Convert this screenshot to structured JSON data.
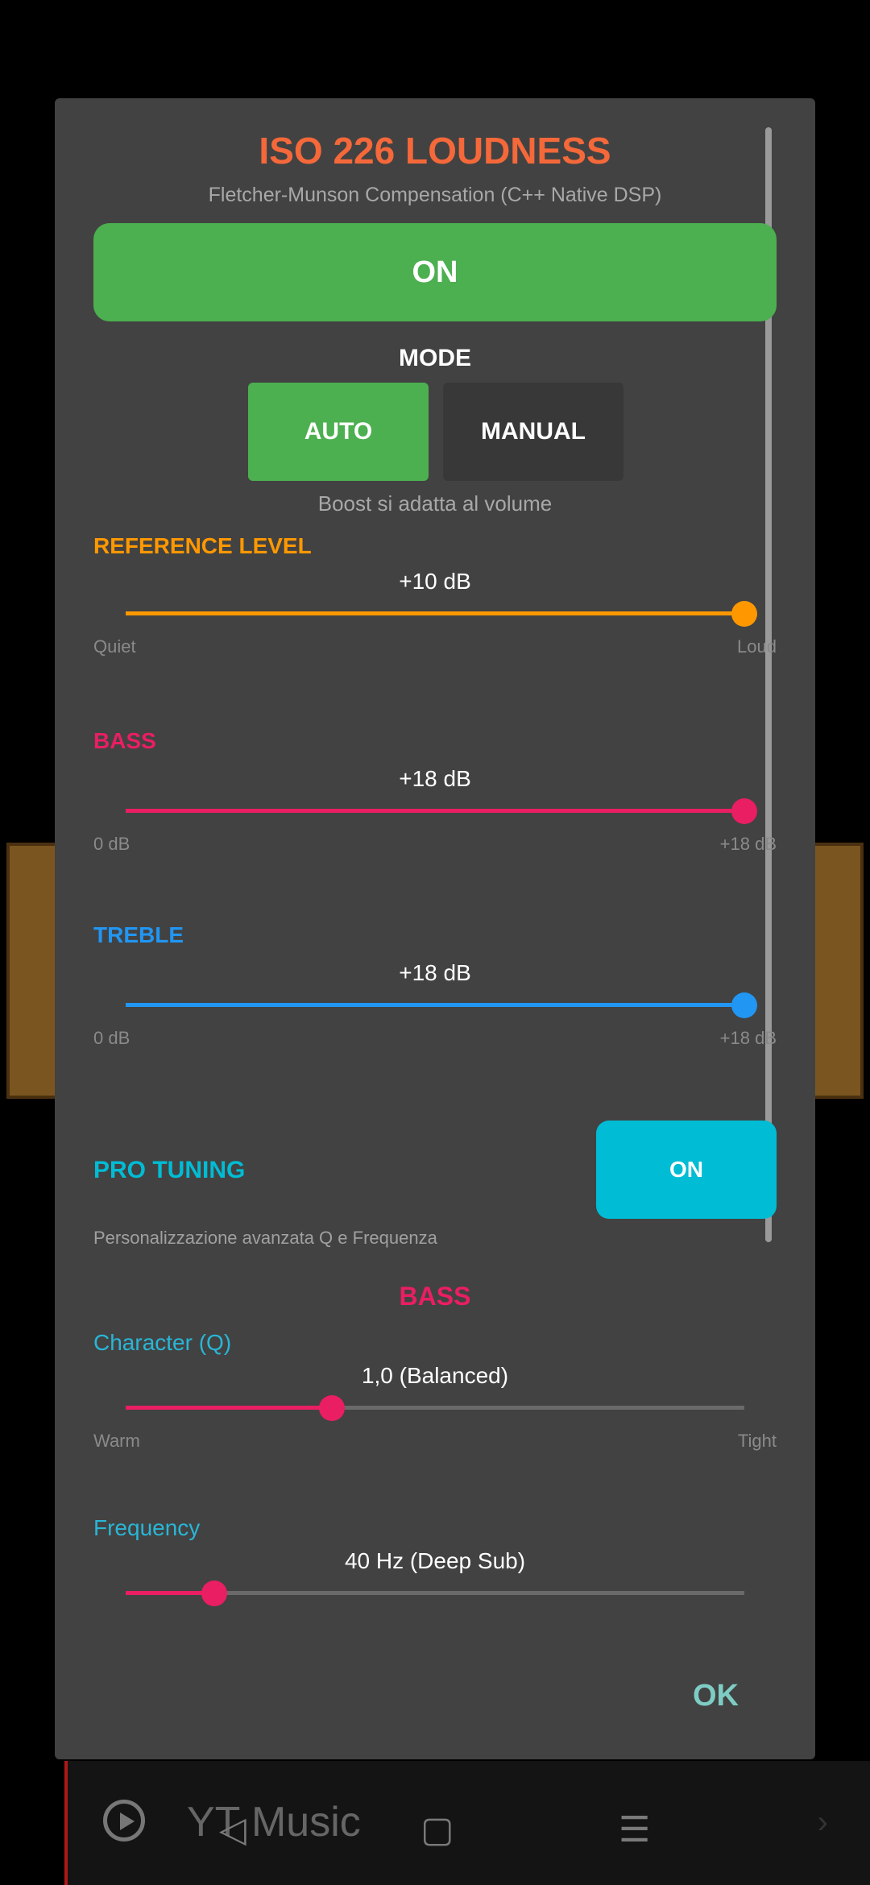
{
  "background": {
    "player_title": "YT Music"
  },
  "dialog": {
    "title": "ISO 226 LOUDNESS",
    "subtitle": "Fletcher-Munson Compensation (C++ Native DSP)",
    "power_toggle": "ON",
    "mode": {
      "label": "MODE",
      "options": [
        "AUTO",
        "MANUAL"
      ],
      "selected": "AUTO",
      "hint": "Boost si adatta al volume"
    },
    "reference_level": {
      "label": "REFERENCE LEVEL",
      "value_text": "+10 dB",
      "min_label": "Quiet",
      "max_label": "Loud",
      "fraction": 1.0,
      "color": "#ff9800"
    },
    "bass": {
      "label": "BASS",
      "value_text": "+18 dB",
      "min_label": "0 dB",
      "max_label": "+18 dB",
      "fraction": 1.0,
      "color": "#e91e63"
    },
    "treble": {
      "label": "TREBLE",
      "value_text": "+18 dB",
      "min_label": "0 dB",
      "max_label": "+18 dB",
      "fraction": 1.0,
      "color": "#2196f3"
    },
    "pro_tuning": {
      "label": "PRO TUNING",
      "toggle": "ON",
      "description": "Personalizzazione avanzata Q e Frequenza",
      "section_header": "BASS",
      "character": {
        "label": "Character (Q)",
        "value_text": "1,0 (Balanced)",
        "min_label": "Warm",
        "max_label": "Tight",
        "fraction": 0.333,
        "color": "#e91e63"
      },
      "frequency": {
        "label": "Frequency",
        "value_text": "40 Hz (Deep Sub)",
        "fraction": 0.143,
        "color": "#e91e63"
      }
    },
    "ok_label": "OK"
  },
  "colors": {
    "accent_title": "#f4683a",
    "on_green": "#4caf50",
    "pro_cyan": "#00bcd4"
  }
}
